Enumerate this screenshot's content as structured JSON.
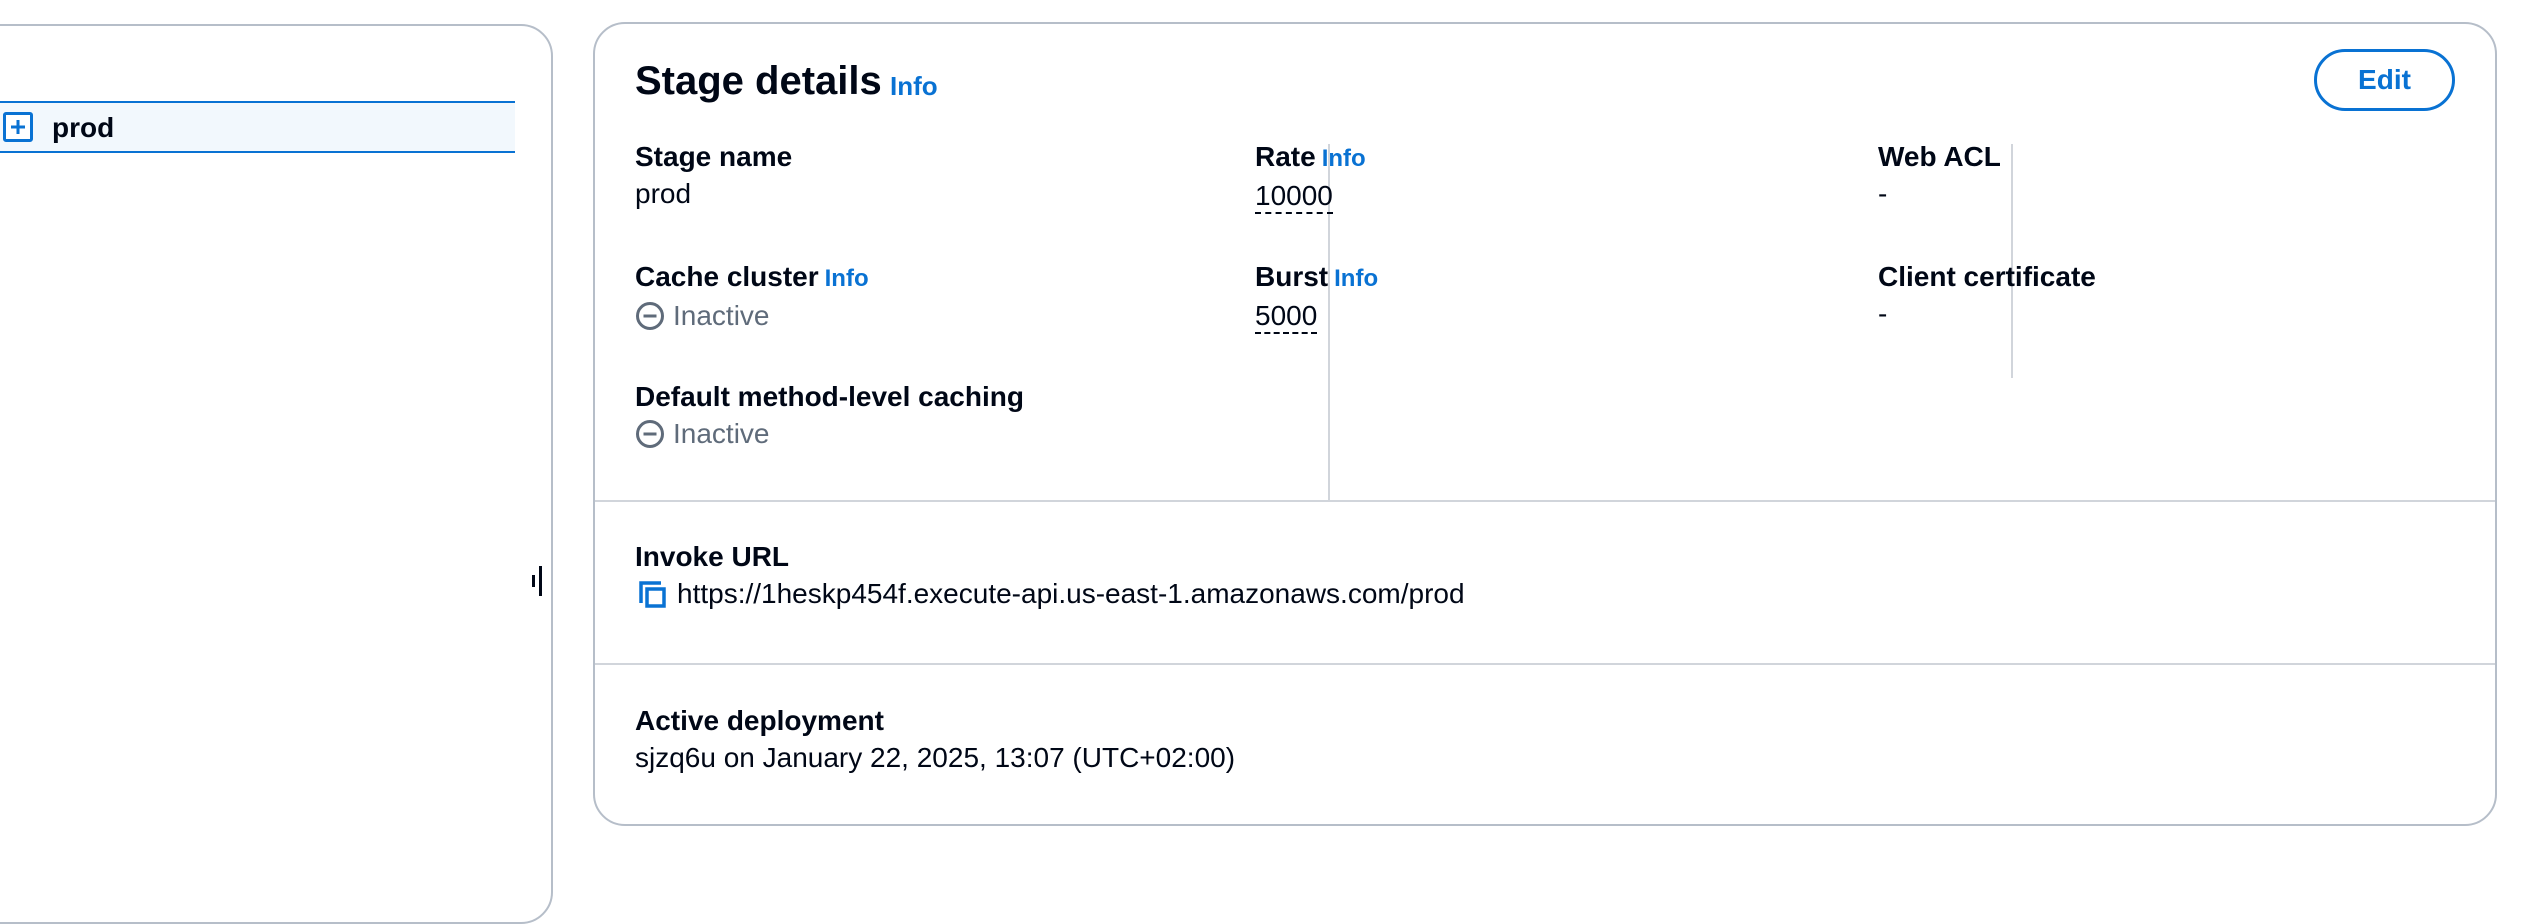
{
  "stage_tree": {
    "items": [
      {
        "label": "prod",
        "icon": "expand-plus-icon"
      }
    ]
  },
  "stage_details": {
    "title": "Stage details",
    "info_label": "Info",
    "edit_label": "Edit",
    "fields": {
      "stage_name": {
        "label": "Stage name",
        "value": "prod"
      },
      "cache_cluster": {
        "label": "Cache cluster",
        "info": "Info",
        "value": "Inactive"
      },
      "default_method_caching": {
        "label": "Default method-level caching",
        "value": "Inactive"
      },
      "rate": {
        "label": "Rate",
        "info": "Info",
        "value": "10000"
      },
      "burst": {
        "label": "Burst",
        "info": "Info",
        "value": "5000"
      },
      "web_acl": {
        "label": "Web ACL",
        "value": "-"
      },
      "client_certificate": {
        "label": "Client certificate",
        "value": "-"
      }
    },
    "invoke_url": {
      "label": "Invoke URL",
      "value": "https://1heskp454f.execute-api.us-east-1.amazonaws.com/prod",
      "icon": "copy-icon"
    },
    "active_deployment": {
      "label": "Active deployment",
      "value": "sjzq6u on January 22, 2025, 13:07 (UTC+02:00)"
    }
  },
  "colors": {
    "link": "#0972d3",
    "text": "#000716",
    "muted": "#5f6b7a",
    "border": "#b6bec9",
    "divider": "#d1d5db",
    "selected_bg": "#f2f8fd"
  }
}
